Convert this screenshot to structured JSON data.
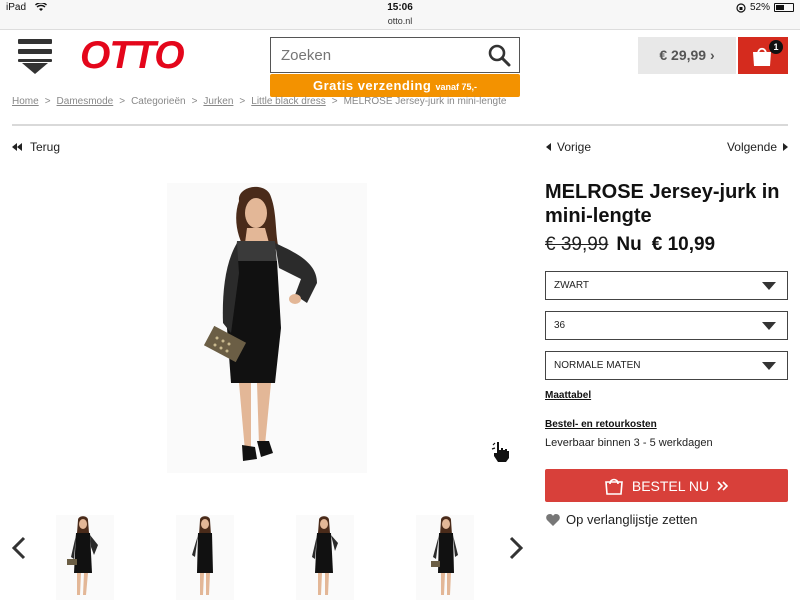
{
  "status_bar": {
    "device": "iPad",
    "time": "15:06",
    "url": "otto.nl",
    "battery": "52%",
    "battery_level": 0.52
  },
  "header": {
    "logo": "OTTO",
    "search_placeholder": "Zoeken",
    "shipping_banner": "Gratis verzending",
    "shipping_banner_small": "vanaf 75,-",
    "cart_total": "€ 29,99 ›",
    "cart_count": "1"
  },
  "breadcrumb": {
    "items": [
      "Home",
      "Damesmode",
      "Categorieën",
      "Jurken",
      "Little black dress",
      "MELROSE Jersey-jurk in mini-lengte"
    ],
    "separator": ">"
  },
  "nav": {
    "back": "Terug",
    "prev": "Vorige",
    "next": "Volgende"
  },
  "product": {
    "title": "MELROSE Jersey-jurk in mini-lengte",
    "old_price": "€ 39,99",
    "now_label": "Nu",
    "price": "€ 10,99",
    "color_select": "ZWART",
    "size_select": "36",
    "fit_select": "NORMALE MATEN",
    "size_chart_link": "Maattabel",
    "shipping_costs_link": "Bestel- en retourkosten",
    "delivery": "Leverbaar binnen 3 - 5 werkdagen",
    "order_button": "BESTEL NU",
    "wishlist": "Op verlanglijstje zetten"
  },
  "colors": {
    "brand_red": "#e4061b",
    "banner_orange": "#f39200",
    "cart_red": "#d52b1e",
    "order_red": "#d8403a"
  }
}
